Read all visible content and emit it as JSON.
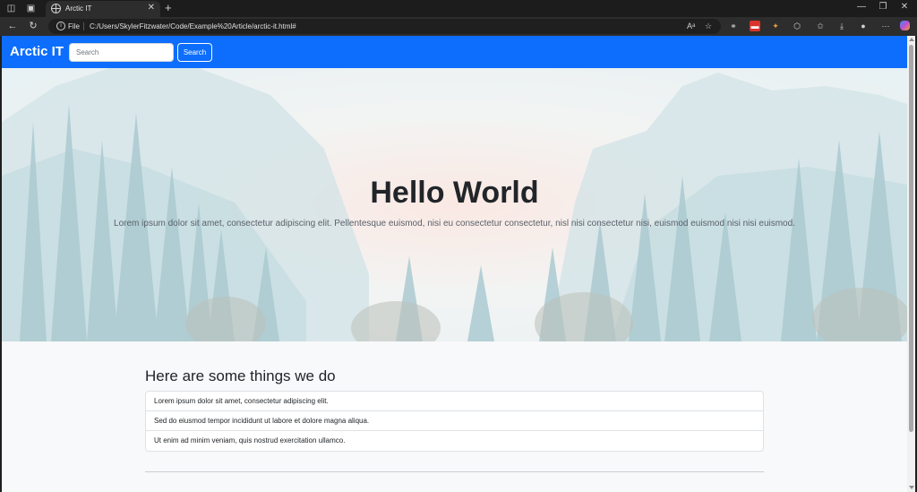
{
  "browser": {
    "tab_title": "Arctic IT",
    "close_glyph": "✕",
    "new_tab_glyph": "+",
    "scheme_label": "File",
    "url": "C:/Users/SkylerFitzwater/Code/Example%20Article/arctic-it.html#",
    "controls": {
      "minimize": "—",
      "restore": "❐",
      "close": "✕"
    }
  },
  "site": {
    "brand": "Arctic IT",
    "search": {
      "placeholder": "Search",
      "value": "",
      "button_label": "Search"
    },
    "primary_color": "#0d6efd"
  },
  "hero": {
    "title": "Hello World",
    "text": "Lorem ipsum dolor sit amet, consectetur adipiscing elit. Pellentesque euismod, nisi eu consectetur consectetur, nisl nisi consectetur nisi, euismod euismod nisi nisi euismod."
  },
  "services": {
    "heading": "Here are some things we do",
    "items": [
      "Lorem ipsum dolor sit amet, consectetur adipiscing elit.",
      "Sed do eiusmod tempor incididunt ut labore et dolore magna aliqua.",
      "Ut enim ad minim veniam, quis nostrud exercitation ullamco."
    ]
  },
  "icons": {
    "read_aloud": "read-aloud-icon",
    "favorite": "star-icon",
    "extensions": [
      "extension-icon-1",
      "extension-icon-2",
      "extension-icon-3",
      "puzzle-icon"
    ],
    "toolbar": [
      "favorites-icon",
      "downloads-icon",
      "profile-icon",
      "more-icon",
      "copilot-icon"
    ]
  }
}
